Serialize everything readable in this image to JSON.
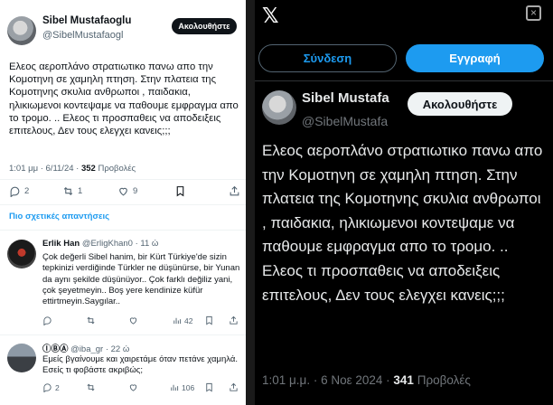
{
  "left": {
    "author": {
      "name": "Sibel Mustafaoglu",
      "handle": "@SibelMustafaogl"
    },
    "follow_label": "Ακολουθήστε",
    "tweet_text": "Ελεος αεροπλάνο στρατιωτικο πανω απο την Κομοτηνη σε χαμηλη πτηση. Στην πλατεια της Κομοτηνης σκυλια ανθρωποι , παιδακια, ηλικιωμενοι κοντεψαμε να παθουμε εμφραγμα απο το τρομο. .. Ελεος τι προσπαθεις να αποδειξεις επιτελους, Δεν τους ελεγχει κανεις;;;",
    "meta": {
      "time_date": "1:01 μμ · 6/11/24 · ",
      "views_count": "352",
      "views_label": " Προβολές"
    },
    "actions": {
      "replies": "2",
      "reposts": "1",
      "likes": "9"
    },
    "relevant_label": "Πιο σχετικές απαντήσεις",
    "replies": [
      {
        "name": "Erlik Han",
        "handle_time": "@ErligKhan0 · 11 ώ",
        "text": "Çok değerli Sibel hanim, bir Kürt Türkiye'de sizin tepkinizi verdiğinde Türkler ne düşünürse, bir Yunan da aynı şekilde düşünüyor.. Çok farklı değiliz yani, çok şeyetmeyin.. Boş yere kendinize küfür ettirtmeyin.Saygılar..",
        "views": "42"
      },
      {
        "name": "ⒾⒷⒶ",
        "handle_time": "@iba_gr · 22 ώ",
        "text": "Εμείς βγαίνουμε και χαιρετάμε όταν πετάνε χαμηλά. Εσείς τι φοβάστε ακριβώς;",
        "replies": "2",
        "views": "106"
      }
    ]
  },
  "right": {
    "logo": "𝕏",
    "close_icon": "×",
    "login_label": "Σύνδεση",
    "signup_label": "Εγγραφή",
    "author": {
      "name": "Sibel Mustafa",
      "handle": "@SibelMustafa"
    },
    "follow_label": "Ακολουθήστε",
    "tweet_text": "Ελεος αεροπλάνο στρατιωτικο πανω απο την Κομοτηνη σε χαμηλη πτηση. Στην πλατεια της Κομοτηνης σκυλια ανθρωποι , παιδακια, ηλικιωμενοι κοντεψαμε να παθουμε εμφραγμα απο το τρομο. .. Ελεος τι προσπαθεις να αποδειξεις επιτελους,  Δεν τους ελεγχει κανεις;;;",
    "meta": {
      "time_date": "1:01 μ.μ. · 6 Νοε 2024 · ",
      "views_count": "341",
      "views_label": " Προβολές"
    }
  },
  "colors": {
    "accent": "#1d9bf0",
    "dark_bg": "#000000",
    "light_bg": "#ffffff"
  },
  "icons": [
    "reply-icon",
    "repost-icon",
    "like-icon",
    "bookmark-icon",
    "share-icon",
    "views-icon",
    "x-logo-icon",
    "close-icon"
  ]
}
